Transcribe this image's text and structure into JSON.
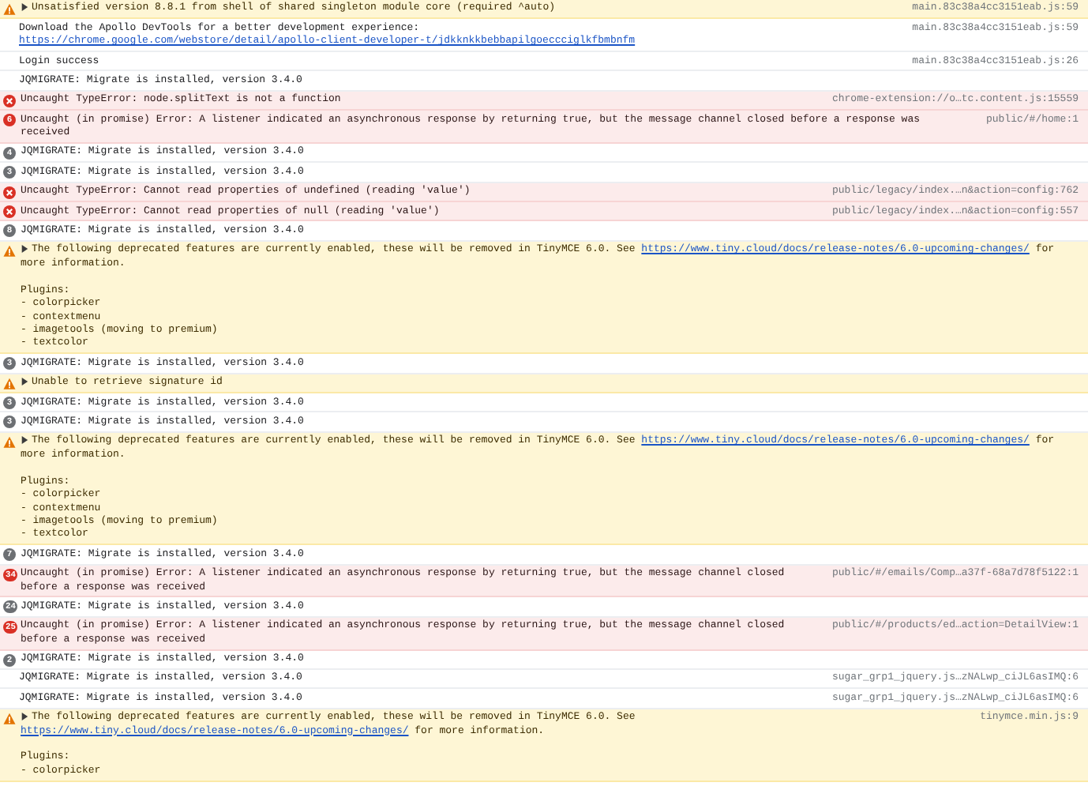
{
  "rows": [
    {
      "kind": "warning",
      "expanded": false,
      "text": "Unsatisfied version 8.8.1 from shell of shared singleton module core (required ^auto)",
      "source": "main.83c38a4cc3151eab.js:59"
    },
    {
      "kind": "log",
      "text": "Download the Apollo DevTools for a better development experience:",
      "link": "https://chrome.google.com/webstore/detail/apollo-client-developer-t/jdkknkkbebbapilgoeccciglkfbmbnfm",
      "source": "main.83c38a4cc3151eab.js:59"
    },
    {
      "kind": "log",
      "text": "Login success",
      "source": "main.83c38a4cc3151eab.js:26"
    },
    {
      "kind": "log",
      "text": "JQMIGRATE: Migrate is installed, version 3.4.0"
    },
    {
      "kind": "error",
      "text": "Uncaught TypeError: node.splitText is not a function",
      "source": "chrome-extension://o…tc.content.js:15559"
    },
    {
      "kind": "error",
      "count": "6",
      "text": "Uncaught (in promise) Error: A listener indicated an asynchronous response by returning true, but the message channel closed before a response was received",
      "source": "public/#/home:1"
    },
    {
      "kind": "log",
      "count": "4",
      "text": "JQMIGRATE: Migrate is installed, version 3.4.0"
    },
    {
      "kind": "log",
      "count": "3",
      "text": "JQMIGRATE: Migrate is installed, version 3.4.0"
    },
    {
      "kind": "error",
      "text": "Uncaught TypeError: Cannot read properties of undefined (reading 'value')",
      "source": "public/legacy/index.…n&action=config:762"
    },
    {
      "kind": "error",
      "text": "Uncaught TypeError: Cannot read properties of null (reading 'value')",
      "source": "public/legacy/index.…n&action=config:557"
    },
    {
      "kind": "log",
      "count": "8",
      "text": "JQMIGRATE: Migrate is installed, version 3.4.0"
    },
    {
      "kind": "warning",
      "expanded": false,
      "text": "The following deprecated features are currently enabled, these will be removed in TinyMCE 6.0. See",
      "link": "https://www.tiny.cloud/docs/release-notes/6.0-upcoming-changes/",
      "text_after": "for more information.",
      "details": [
        "Plugins:",
        "- colorpicker",
        "- contextmenu",
        "- imagetools (moving to premium)",
        "- textcolor"
      ]
    },
    {
      "kind": "log",
      "count": "3",
      "text": "JQMIGRATE: Migrate is installed, version 3.4.0"
    },
    {
      "kind": "warning",
      "expanded": false,
      "text": "Unable to retrieve signature id"
    },
    {
      "kind": "log",
      "count": "3",
      "text": "JQMIGRATE: Migrate is installed, version 3.4.0"
    },
    {
      "kind": "log",
      "count": "3",
      "text": "JQMIGRATE: Migrate is installed, version 3.4.0"
    },
    {
      "kind": "warning",
      "expanded": false,
      "text": "The following deprecated features are currently enabled, these will be removed in TinyMCE 6.0. See",
      "link": "https://www.tiny.cloud/docs/release-notes/6.0-upcoming-changes/",
      "text_after": "for more information.",
      "details": [
        "Plugins:",
        "- colorpicker",
        "- contextmenu",
        "- imagetools (moving to premium)",
        "- textcolor"
      ]
    },
    {
      "kind": "log",
      "count": "7",
      "text": "JQMIGRATE: Migrate is installed, version 3.4.0"
    },
    {
      "kind": "error",
      "count": "34",
      "text": "Uncaught (in promise) Error: A listener indicated an asynchronous response by returning true, but the message channel closed before a response was received",
      "source": "public/#/emails/Comp…a37f-68a7d78f5122:1"
    },
    {
      "kind": "log",
      "count": "24",
      "text": "JQMIGRATE: Migrate is installed, version 3.4.0"
    },
    {
      "kind": "error",
      "count": "25",
      "text": "Uncaught (in promise) Error: A listener indicated an asynchronous response by returning true, but the message channel closed before a response was received",
      "source": "public/#/products/ed…action=DetailView:1"
    },
    {
      "kind": "log",
      "count": "2",
      "text": "JQMIGRATE: Migrate is installed, version 3.4.0"
    },
    {
      "kind": "log",
      "text": "JQMIGRATE: Migrate is installed, version 3.4.0",
      "source": "sugar_grp1_jquery.js…zNALwp_ciJL6asIMQ:6"
    },
    {
      "kind": "log",
      "text": "JQMIGRATE: Migrate is installed, version 3.4.0",
      "source": "sugar_grp1_jquery.js…zNALwp_ciJL6asIMQ:6"
    },
    {
      "kind": "warning",
      "expanded": false,
      "text": "The following deprecated features are currently enabled, these will be removed in TinyMCE 6.0. See",
      "link": "https://www.tiny.cloud/docs/release-notes/6.0-upcoming-changes/",
      "text_after": "for more information.",
      "details": [
        "Plugins:",
        "- colorpicker"
      ],
      "source": "tinymce.min.js:9"
    }
  ]
}
